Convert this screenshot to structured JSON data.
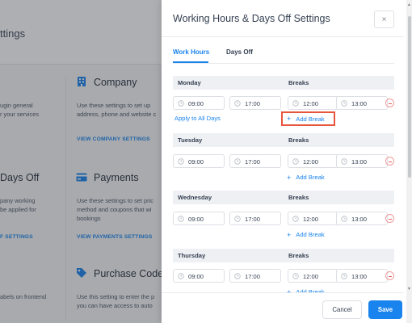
{
  "background": {
    "page_title": "ttings",
    "sections": [
      {
        "title": "Company",
        "text": [
          "Use these settings to set up",
          "address, phone and website c"
        ],
        "link": "VIEW COMPANY SETTINGS",
        "left_text": [
          "ugin general",
          "r your services"
        ]
      },
      {
        "title": "Payments",
        "text": [
          "Use these settings to set pric",
          "method and coupons that wi",
          "bookings"
        ],
        "link": "VIEW PAYMENTS SETTINGS",
        "left_title": "Days Off",
        "left_text": [
          "pany working",
          "be applied for"
        ],
        "left_link": "F SETTINGS"
      },
      {
        "title": "Purchase Code",
        "text": [
          "Use this setting to enter the p",
          "you can have access to auto"
        ],
        "left_text": [
          "abels on frontend"
        ]
      }
    ]
  },
  "modal": {
    "title": "Working Hours & Days Off Settings",
    "close_label": "×",
    "tabs": [
      {
        "label": "Work Hours",
        "active": true
      },
      {
        "label": "Days Off",
        "active": false
      }
    ],
    "breaks_label": "Breaks",
    "apply_all_label": "Apply to All Days",
    "add_break_label": "Add Break",
    "add_break_icon": "+",
    "days": [
      {
        "name": "Monday",
        "start": "09:00",
        "end": "17:00",
        "break_start": "12:00",
        "break_end": "13:00",
        "apply_all": true,
        "add_break_highlighted": true
      },
      {
        "name": "Tuesday",
        "start": "09:00",
        "end": "17:00",
        "break_start": "12:00",
        "break_end": "13:00"
      },
      {
        "name": "Wednesday",
        "start": "09:00",
        "end": "17:00",
        "break_start": "12:00",
        "break_end": "13:00"
      },
      {
        "name": "Thursday",
        "start": "09:00",
        "end": "17:00",
        "break_start": "12:00",
        "break_end": "13:00"
      }
    ],
    "cancel_label": "Cancel",
    "save_label": "Save",
    "accent_color": "#1a84ee",
    "highlight_color": "#e8553d"
  }
}
